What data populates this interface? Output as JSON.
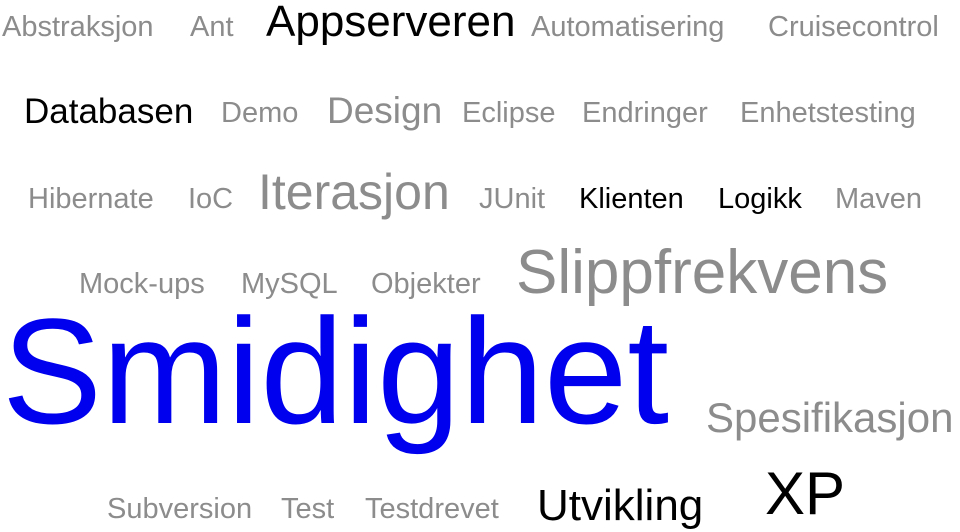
{
  "colors": {
    "default": "#8c8c8c",
    "emphasis": "#000000",
    "highlight": "#0000ee"
  },
  "words": [
    {
      "text": "Abstraksjon",
      "tone": "default"
    },
    {
      "text": "Ant",
      "tone": "default"
    },
    {
      "text": "Appserveren",
      "tone": "emphasis"
    },
    {
      "text": "Automatisering",
      "tone": "default"
    },
    {
      "text": "Cruisecontrol",
      "tone": "default"
    },
    {
      "text": "Databasen",
      "tone": "emphasis"
    },
    {
      "text": "Demo",
      "tone": "default"
    },
    {
      "text": "Design",
      "tone": "default"
    },
    {
      "text": "Eclipse",
      "tone": "default"
    },
    {
      "text": "Endringer",
      "tone": "default"
    },
    {
      "text": "Enhetstesting",
      "tone": "default"
    },
    {
      "text": "Hibernate",
      "tone": "default"
    },
    {
      "text": "IoC",
      "tone": "default"
    },
    {
      "text": "Iterasjon",
      "tone": "default"
    },
    {
      "text": "JUnit",
      "tone": "default"
    },
    {
      "text": "Klienten",
      "tone": "emphasis"
    },
    {
      "text": "Logikk",
      "tone": "emphasis"
    },
    {
      "text": "Maven",
      "tone": "default"
    },
    {
      "text": "Mock-ups",
      "tone": "default"
    },
    {
      "text": "MySQL",
      "tone": "default"
    },
    {
      "text": "Objekter",
      "tone": "default"
    },
    {
      "text": "Slippfrekvens",
      "tone": "default"
    },
    {
      "text": "Smidighet",
      "tone": "highlight"
    },
    {
      "text": "Spesifikasjon",
      "tone": "default"
    },
    {
      "text": "Subversion",
      "tone": "default"
    },
    {
      "text": "Test",
      "tone": "default"
    },
    {
      "text": "Testdrevet",
      "tone": "default"
    },
    {
      "text": "Utvikling",
      "tone": "emphasis"
    },
    {
      "text": "XP",
      "tone": "emphasis"
    }
  ]
}
